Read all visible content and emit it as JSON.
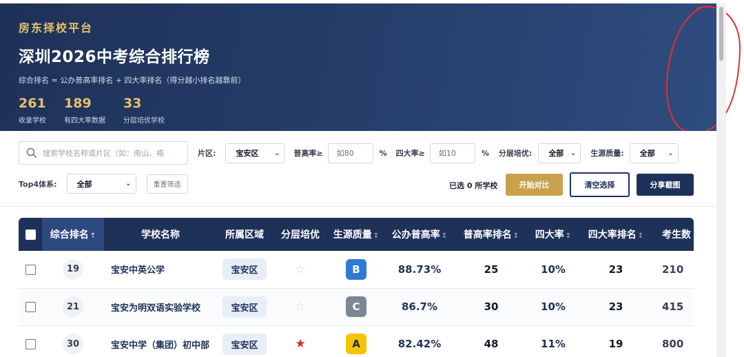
{
  "header": {
    "brand": "房东择校平台",
    "title": "深圳2026中考综合排行榜",
    "subtitle": "综合排名 = 公办普高率排名 + 四大率排名（得分越小排名越靠前）",
    "stats": [
      {
        "value": "261",
        "label": "收录学校"
      },
      {
        "value": "189",
        "label": "有四大率数据"
      },
      {
        "value": "33",
        "label": "分层培优学校"
      }
    ]
  },
  "filters": {
    "search_placeholder": "搜索学校名称或片区（如：南山、袼",
    "district_label": "片区:",
    "district_value": "宝安区",
    "high_rate_label": "普高率≥",
    "high_rate_placeholder": "如80",
    "four_rate_label": "四大率≥",
    "four_rate_placeholder": "如10",
    "percent": "%",
    "layered_label": "分层培优:",
    "layered_value": "全部",
    "source_label": "生源质量:",
    "source_value": "全部",
    "top4_label": "Top4体系:",
    "top4_value": "全部",
    "reset_label": "重置筛选"
  },
  "actions": {
    "selected_count": "已选 0 所学校",
    "compare_label": "开始对比",
    "clear_label": "清空选择",
    "share_label": "分享截图"
  },
  "table": {
    "columns": {
      "rank": "综合排名",
      "name": "学校名称",
      "district": "所属区域",
      "layered": "分层培优",
      "source": "生源质量",
      "high_rate": "公办普高率",
      "high_rank": "普高率排名",
      "four_rate": "四大率",
      "four_rank": "四大率排名",
      "students": "考生数"
    },
    "sort_asc": "↑",
    "sort_both": "↕",
    "rows": [
      {
        "rank": "19",
        "name": "宝安中英公学",
        "district": "宝安区",
        "layered": "☆",
        "source": "B",
        "high_rate": "88.73%",
        "high_rank": "25",
        "four_rate": "10%",
        "four_rank": "23",
        "students": "210"
      },
      {
        "rank": "21",
        "name": "宝安为明双语实验学校",
        "district": "宝安区",
        "layered": "☆",
        "source": "C",
        "high_rate": "86.7%",
        "high_rank": "30",
        "four_rate": "10%",
        "four_rank": "23",
        "students": "415"
      },
      {
        "rank": "30",
        "name": "宝安中学（集团）初中部",
        "district": "宝安区",
        "layered": "★",
        "source": "A",
        "high_rate": "82.42%",
        "high_rank": "48",
        "four_rate": "11%",
        "four_rank": "19",
        "students": "800"
      }
    ]
  }
}
